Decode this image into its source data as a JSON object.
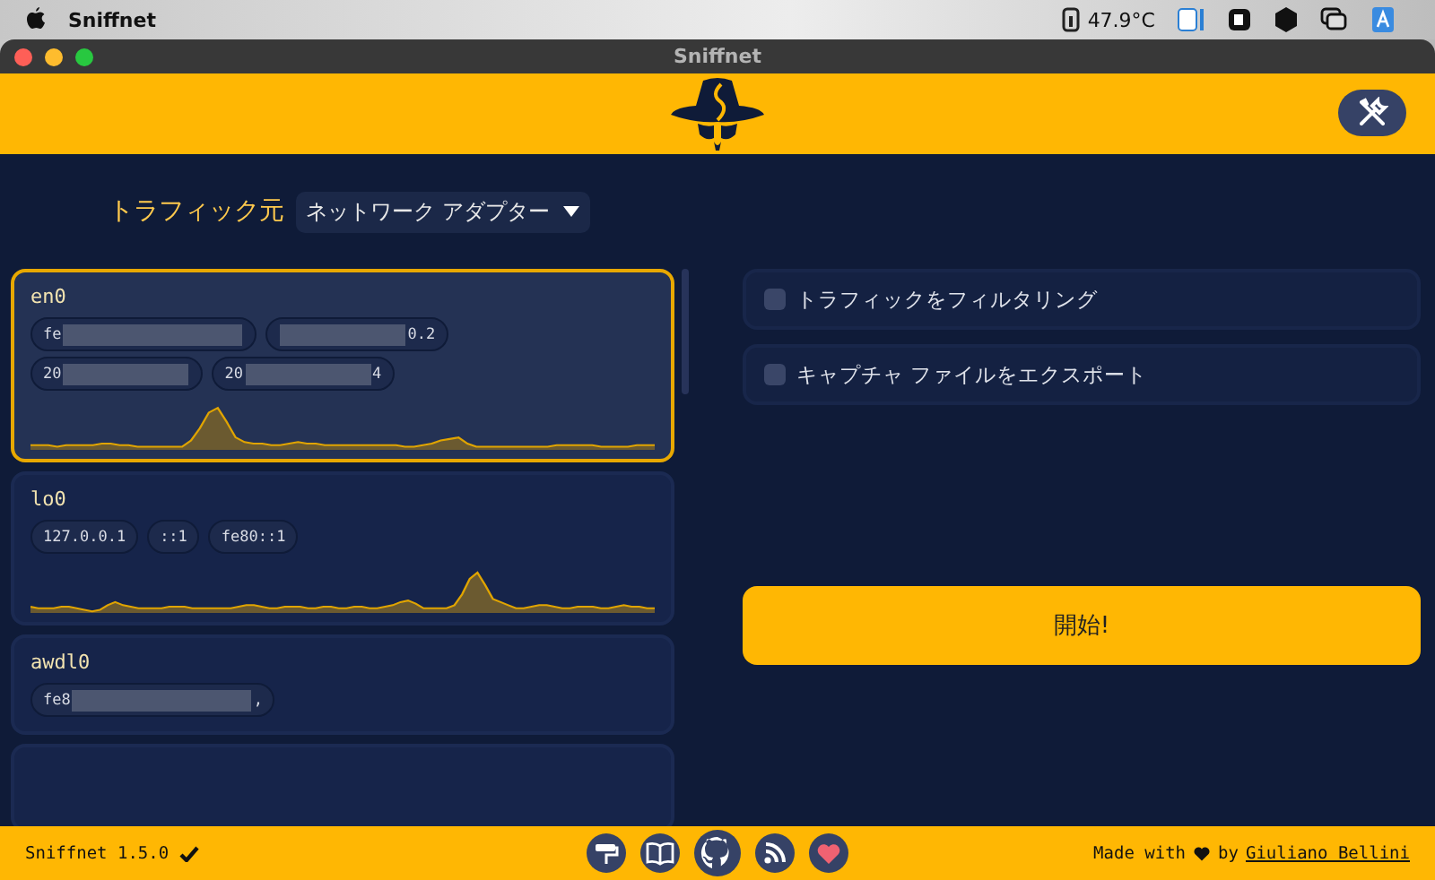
{
  "menu_bar": {
    "app_name": "Sniffnet",
    "temperature": "47.9°C"
  },
  "window": {
    "title": "Sniffnet"
  },
  "source": {
    "label": "トラフィック元",
    "dropdown": "ネットワーク アダプター"
  },
  "adapters": [
    {
      "name": "en0",
      "selected": true,
      "graph": true,
      "addresses": [
        {
          "prefix": "fe",
          "redacted": true
        },
        {
          "suffix": "0.2",
          "redacted": true
        },
        {
          "prefix": "20",
          "redacted": true
        },
        {
          "prefix": "20",
          "suffix": "4",
          "redacted": true
        }
      ]
    },
    {
      "name": "lo0",
      "selected": false,
      "graph": true,
      "addresses": [
        {
          "prefix": "127.0.0.1",
          "redacted": false
        },
        {
          "prefix": "::1",
          "redacted": false
        },
        {
          "prefix": "fe80::1",
          "redacted": false
        }
      ]
    },
    {
      "name": "awdl0",
      "selected": false,
      "graph": false,
      "addresses": [
        {
          "prefix": "fe8",
          "suffix": ",",
          "redacted": true
        }
      ]
    },
    {
      "selected": false,
      "graph": false
    }
  ],
  "options": [
    {
      "label": "トラフィックをフィルタリング",
      "checked": false
    },
    {
      "label": "キャプチャ ファイルをエクスポート",
      "checked": false
    }
  ],
  "start_button": "開始!",
  "footer": {
    "version": "Sniffnet 1.5.0",
    "made_with": "Made with",
    "by": "by",
    "author": "Giuliano Bellini"
  }
}
